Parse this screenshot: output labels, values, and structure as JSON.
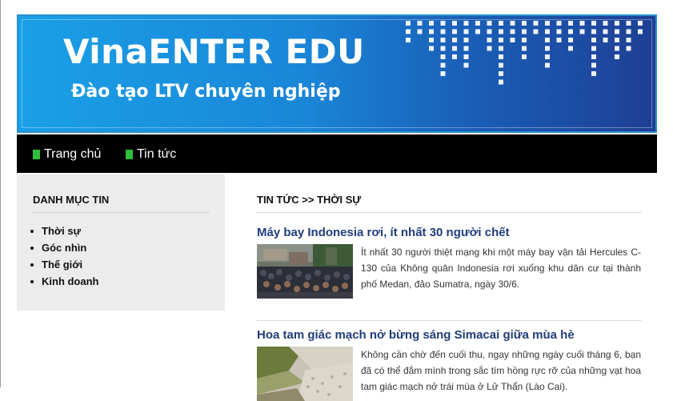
{
  "banner": {
    "title": "VinaENTER EDU",
    "subtitle": "Đào tạo LTV chuyên nghiệp"
  },
  "nav": {
    "items": [
      {
        "label": "Trang chủ"
      },
      {
        "label": "Tin tức"
      }
    ]
  },
  "sidebar": {
    "title": "DANH MỤC TIN",
    "items": [
      {
        "label": "Thời sự"
      },
      {
        "label": "Góc nhìn"
      },
      {
        "label": "Thế giới"
      },
      {
        "label": "Kinh doanh"
      }
    ]
  },
  "main": {
    "breadcrumb": "TIN TỨC >> THỜI SỰ",
    "articles": [
      {
        "title": "Máy bay Indonesia rơi, ít nhất 30 người chết",
        "summary": "Ít nhất 30 người thiệt mạng khi một máy bay vận tải Hercules C-130 của Không quân Indonesia rơi xuống khu dân cư tại thành phố Medan, đảo Sumatra, ngày 30/6."
      },
      {
        "title": "Hoa tam giác mạch nở bừng sáng Simacai giữa mùa hè",
        "summary": "Không cần chờ đến cuối thu, ngay những ngày cuối tháng 6, bạn đã có thể đắm mình trong sắc tím hồng rực rỡ của những vạt hoa tam giác mạch nở trái mùa ở Lử Thẩn (Lào Cai)."
      }
    ]
  },
  "colors": {
    "nav_bg": "#000000",
    "nav_bullet": "#2dbf3a",
    "article_title": "#1f3d7a",
    "sidebar_bg": "#ececec"
  }
}
